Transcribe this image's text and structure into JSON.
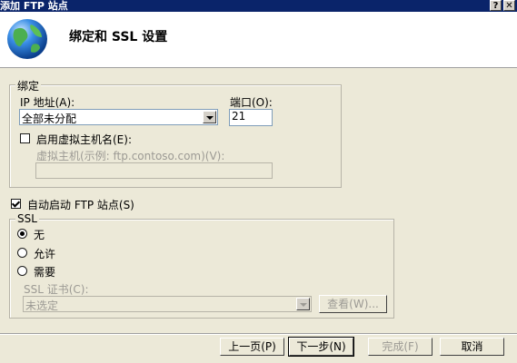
{
  "window": {
    "title": "添加 FTP 站点",
    "help_label": "?",
    "close_label": "✕"
  },
  "header": {
    "title": "绑定和 SSL 设置",
    "icon": "globe-icon"
  },
  "binding": {
    "legend": "绑定",
    "ip_label": "IP 地址(A):",
    "ip_value": "全部未分配",
    "port_label": "端口(O):",
    "port_value": "21",
    "vhost_checkbox_label": "启用虚拟主机名(E):",
    "vhost_checked": false,
    "vhost_field_label": "虚拟主机(示例: ftp.contoso.com)(V):",
    "vhost_value": ""
  },
  "autostart": {
    "label": "自动启动 FTP 站点(S)",
    "checked": true
  },
  "ssl": {
    "legend": "SSL",
    "options": [
      "无",
      "允许",
      "需要"
    ],
    "selected": "无",
    "cert_label": "SSL 证书(C):",
    "cert_value": "未选定",
    "view_button": "查看(W)..."
  },
  "footer": {
    "prev_label": "上一页(P)",
    "next_label": "下一步(N)",
    "finish_label": "完成(F)",
    "cancel_label": "取消"
  },
  "colors": {
    "titlebar": "#0a246a",
    "dialog_bg": "#ece9d8",
    "header_bg": "#ffffff"
  }
}
